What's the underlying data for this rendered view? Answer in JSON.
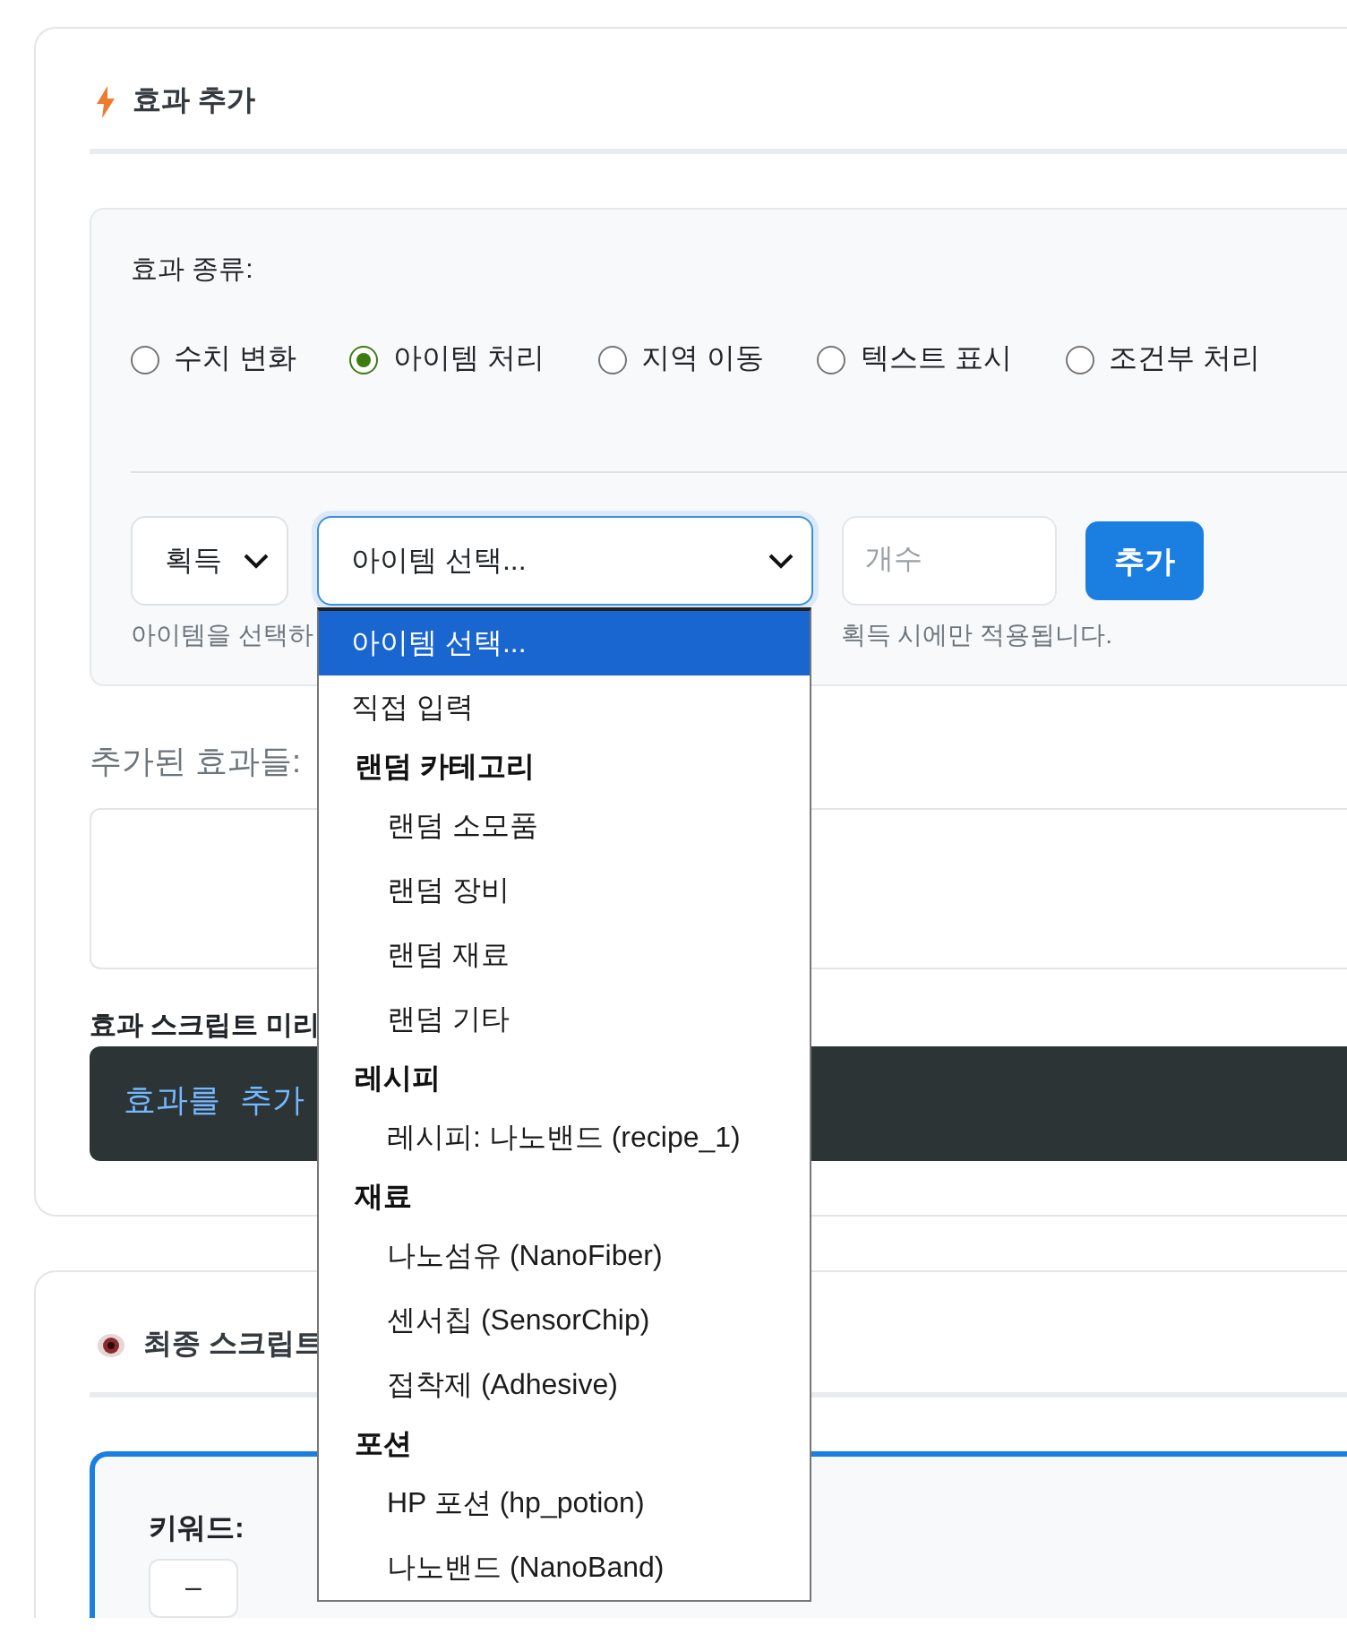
{
  "add_effect": {
    "title": "효과 추가",
    "type_label": "효과 종류:",
    "effect_types": [
      {
        "label": "수치 변화",
        "selected": false
      },
      {
        "label": "아이템 처리",
        "selected": true
      },
      {
        "label": "지역 이동",
        "selected": false
      },
      {
        "label": "텍스트 표시",
        "selected": false
      },
      {
        "label": "조건부 처리",
        "selected": false
      }
    ],
    "action_select": {
      "value": "획득"
    },
    "item_select": {
      "value": "아이템 선택...",
      "expanded": true,
      "options": [
        {
          "kind": "option",
          "label": "아이템 선택...",
          "selected": true
        },
        {
          "kind": "option",
          "label": "직접 입력",
          "selected": false
        },
        {
          "kind": "group",
          "label": "랜덤 카테고리",
          "children": [
            {
              "label": "랜덤 소모품",
              "selected": false
            },
            {
              "label": "랜덤 장비",
              "selected": false
            },
            {
              "label": "랜덤 재료",
              "selected": false
            },
            {
              "label": "랜덤 기타",
              "selected": false
            }
          ]
        },
        {
          "kind": "group",
          "label": "레시피",
          "children": [
            {
              "label": "레시피: 나노밴드 (recipe_1)",
              "selected": false
            }
          ]
        },
        {
          "kind": "group",
          "label": "재료",
          "children": [
            {
              "label": "나노섬유 (NanoFiber)",
              "selected": false
            },
            {
              "label": "센서칩 (SensorChip)",
              "selected": false
            },
            {
              "label": "접착제 (Adhesive)",
              "selected": false
            }
          ]
        },
        {
          "kind": "group",
          "label": "포션",
          "children": [
            {
              "label": "HP 포션 (hp_potion)",
              "selected": false
            },
            {
              "label": "나노밴드 (NanoBand)",
              "selected": false
            }
          ]
        }
      ]
    },
    "count_field": {
      "placeholder": "개수"
    },
    "add_button": "추가",
    "hint_parts": [
      "아이템을 선택하",
      "획득 시에만 적용됩니다."
    ],
    "added_label": "추가된 효과들:",
    "preview_label": "효과 스크립트 미리",
    "preview_text": "효과를  추가"
  },
  "final_script": {
    "title": "최종 스크립트",
    "keyword_label": "키워드:",
    "keyword_value": "–"
  }
}
